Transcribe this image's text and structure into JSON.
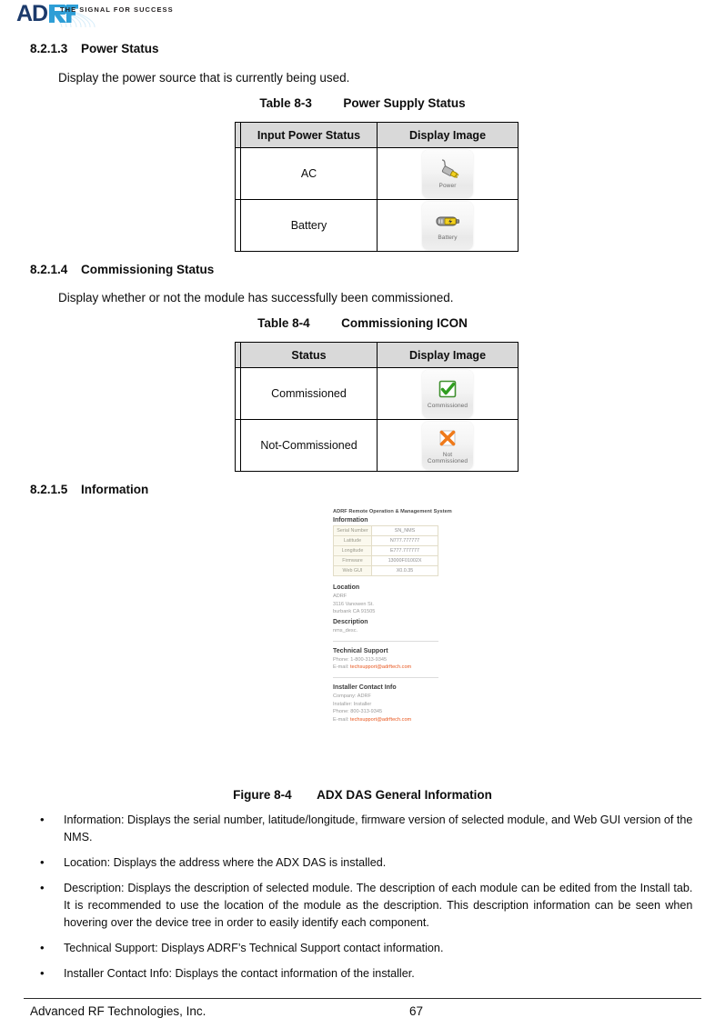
{
  "header": {
    "logo_text": "ADRF",
    "tagline": "THE SIGNAL FOR SUCCESS",
    "brand_color": "#2e9ed6",
    "logo_dark": "#1b3a6b"
  },
  "sections": [
    {
      "number": "8.2.1.3",
      "title": "Power Status",
      "body": "Display the power source that is currently being used."
    },
    {
      "number": "8.2.1.4",
      "title": "Commissioning Status",
      "body": "Display whether or not the module has successfully been commissioned."
    },
    {
      "number": "8.2.1.5",
      "title": "Information",
      "body": ""
    }
  ],
  "table_power": {
    "caption_number": "Table 8-3",
    "caption_title": "Power Supply Status",
    "headers": [
      "Input Power Status",
      "Display Image"
    ],
    "rows": [
      {
        "status": "AC",
        "icon_name": "power-plug-icon",
        "icon_caption": "Power"
      },
      {
        "status": "Battery",
        "icon_name": "battery-icon",
        "icon_caption": "Battery"
      }
    ]
  },
  "table_commissioning": {
    "caption_number": "Table 8-4",
    "caption_title": "Commissioning ICON",
    "headers": [
      "Status",
      "Display Image"
    ],
    "rows": [
      {
        "status": "Commissioned",
        "icon_name": "green-check-icon",
        "icon_caption": "Commissioned"
      },
      {
        "status": "Not-Commissioned",
        "icon_name": "orange-x-icon",
        "icon_caption": "Not\nCommissioned"
      }
    ]
  },
  "figure": {
    "caption_number": "Figure 8-4",
    "caption_title": "ADX DAS General Information",
    "nms": {
      "app_title": "ADRF Remote Operation & Management System",
      "information_heading": "Information",
      "info_rows": [
        {
          "key": "Serial Number",
          "value": "SN_NMS"
        },
        {
          "key": "Latitude",
          "value": "N777.777777"
        },
        {
          "key": "Longitude",
          "value": "E777.777777"
        },
        {
          "key": "Firmware",
          "value": "13000F01002X"
        },
        {
          "key": "Web GUI",
          "value": "X0.0.35"
        }
      ],
      "location_heading": "Location",
      "location_lines": [
        "ADRF",
        "3116 Vanowen St.",
        "burbank CA 91505"
      ],
      "description_heading": "Description",
      "description_value": "nms_desc.",
      "tech_support_heading": "Technical Support",
      "tech_support_phone_label": "Phone: 1-800-313-9345",
      "tech_support_email_label": "E-mail: ",
      "tech_support_email": "techsupport@adrftech.com",
      "installer_heading": "Installer Contact Info",
      "installer_company": "Company: ADRF",
      "installer_name": "Installer: Installer",
      "installer_phone": "Phone: 800-313-9345",
      "installer_email_label": "E-mail: ",
      "installer_email": "techsupport@adrftech.com",
      "link_color": "#e8571f"
    }
  },
  "bullets": [
    "Information: Displays the serial number, latitude/longitude, firmware version of selected module, and Web GUI version of the NMS.",
    "Location: Displays the address where the ADX DAS is installed.",
    "Description: Displays the description of selected module.  The description of each module can be edited from the Install tab.  It is recommended to use the location of the module as the description.  This description information can be seen when hovering over the device tree in order to easily identify each component.",
    "Technical Support: Displays ADRF’s Technical Support contact information.",
    "Installer Contact Info: Displays the contact information of the installer."
  ],
  "footer": {
    "company": "Advanced RF Technologies, Inc.",
    "page_number": "67"
  }
}
